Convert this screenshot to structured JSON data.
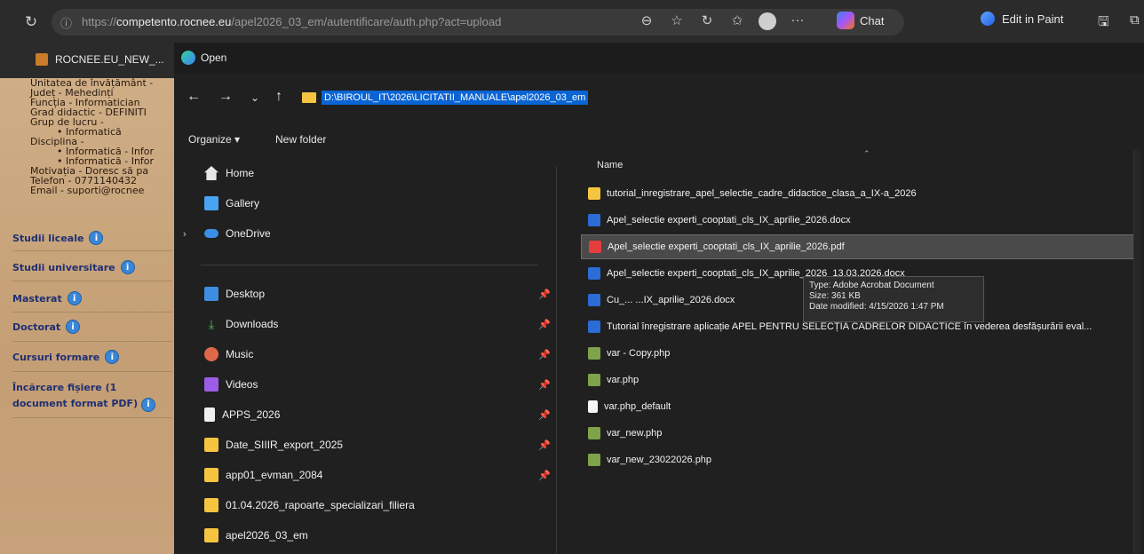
{
  "browser": {
    "url_prefix": "https://",
    "url_domain": "competento.rocnee.eu",
    "url_path": "/apel2026_03_em/autentificare/auth.php?act=upload",
    "chat_label": "Chat",
    "paint_label": "Edit in Paint"
  },
  "bg_tab": {
    "title": "ROCNEE.EU_NEW_..."
  },
  "bg_page": {
    "list": [
      "Unitatea de învățământ -",
      "Județ - Mehedinți",
      "Funcția - Informatician",
      "Grad didactic - DEFINITI",
      "Grup de lucru -",
      "• Informatică",
      "Disciplina -",
      "• Informatică - Infor",
      "• Informatică - Infor",
      "Motivația - Doresc să pa",
      "Telefon - 0771140432",
      "Email - suporti@rocnee"
    ],
    "sections": [
      "Studii liceale",
      "Studii universitare",
      "Masterat",
      "Doctorat",
      "Cursuri formare",
      "Încărcare fișiere (1 document format PDF)"
    ]
  },
  "dialog": {
    "title": "Open",
    "path": "D:\\BIROUL_IT\\2026\\LICITATII_MANUALE\\apel2026_03_em",
    "organize_label": "Organize ▾",
    "new_folder_label": "New folder",
    "nav_top": [
      {
        "label": "Home",
        "icon": "home-icon"
      },
      {
        "label": "Gallery",
        "icon": "gallery-icon"
      },
      {
        "label": "OneDrive",
        "icon": "cloud-icon"
      }
    ],
    "nav_pinned": [
      {
        "label": "Desktop",
        "icon": "desktop-icon",
        "pinned": true
      },
      {
        "label": "Downloads",
        "icon": "download-icon",
        "pinned": true
      },
      {
        "label": "Music",
        "icon": "music-icon",
        "pinned": true
      },
      {
        "label": "Videos",
        "icon": "video-icon",
        "pinned": true
      },
      {
        "label": "APPS_2026",
        "icon": "file-icon",
        "pinned": true
      },
      {
        "label": "Date_SIIIR_export_2025",
        "icon": "folder-icon",
        "pinned": true
      },
      {
        "label": "app01_evman_2084",
        "icon": "folder-icon",
        "pinned": true
      },
      {
        "label": "01.04.2026_rapoarte_specializari_filiera",
        "icon": "folder-icon",
        "pinned": false
      },
      {
        "label": "apel2026_03_em",
        "icon": "folder-icon",
        "pinned": false
      }
    ],
    "column_name": "Name",
    "files": [
      {
        "name": "tutorial_inregistrare_apel_selectie_cadre_didactice_clasa_a_IX-a_2026",
        "type": "folder"
      },
      {
        "name": "Apel_selectie experti_cooptati_cls_IX_aprilie_2026.docx",
        "type": "docx"
      },
      {
        "name": "Apel_selectie experti_cooptati_cls_IX_aprilie_2026.pdf",
        "type": "pdf",
        "selected": true
      },
      {
        "name": "Apel_selectie experti_cooptati_cls_IX_aprilie_2026_13.03.2026.docx",
        "type": "docx"
      },
      {
        "name": "Cu_... ...IX_aprilie_2026.docx",
        "type": "docx"
      },
      {
        "name": "Tutorial înregistrare aplicație APEL PENTRU SELECȚIA CADRELOR DIDACTICE în vederea desfășurării eval...",
        "type": "docx"
      },
      {
        "name": "var - Copy.php",
        "type": "php"
      },
      {
        "name": "var.php",
        "type": "php"
      },
      {
        "name": "var.php_default",
        "type": "file"
      },
      {
        "name": "var_new.php",
        "type": "php"
      },
      {
        "name": "var_new_23022026.php",
        "type": "php"
      }
    ],
    "tooltip": {
      "line1": "Type: Adobe Acrobat Document",
      "line2": "Size: 361 KB",
      "line3": "Date modified: 4/15/2026 1:47 PM"
    }
  }
}
